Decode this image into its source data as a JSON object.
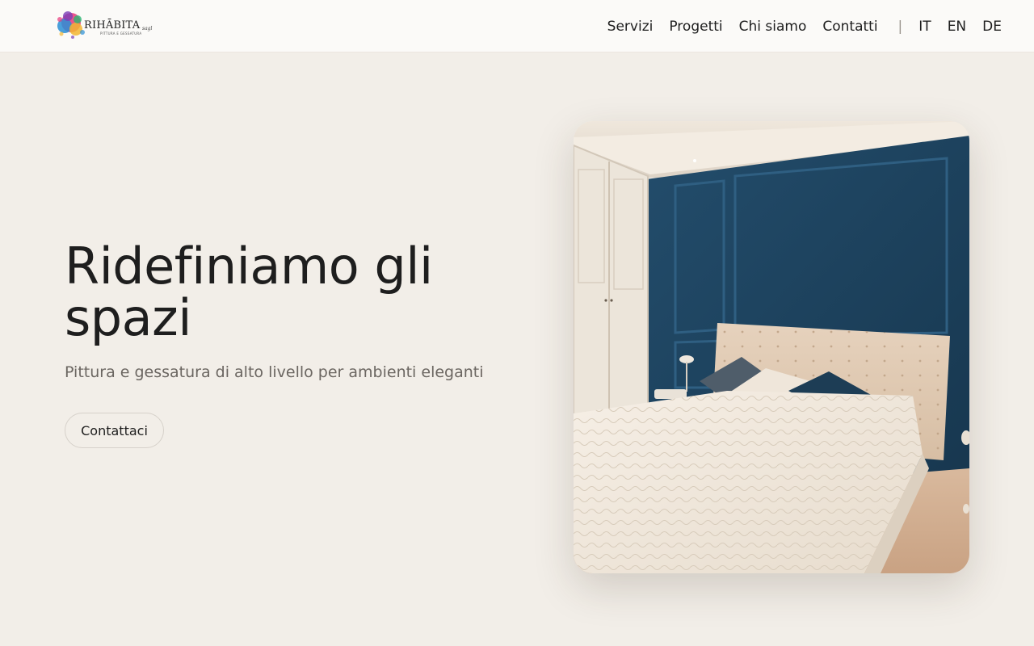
{
  "header": {
    "logo": {
      "wordmark": "RIHĀBITA",
      "suffix": "sagl",
      "tagline": "PITTURA E GESSATURA"
    },
    "nav": {
      "links": [
        {
          "label": "Servizi"
        },
        {
          "label": "Progetti"
        },
        {
          "label": "Chi siamo"
        },
        {
          "label": "Contatti"
        }
      ],
      "separator": "|",
      "languages": [
        {
          "label": "IT"
        },
        {
          "label": "EN"
        },
        {
          "label": "DE"
        }
      ]
    }
  },
  "hero": {
    "title": "Ridefiniamo gli spazi",
    "subtitle": "Pittura e gessatura di alto livello per ambienti eleganti",
    "cta_label": "Contattaci"
  },
  "photo": {
    "subject": "bedroom-with-blue-paneled-wall"
  },
  "colors": {
    "background": "#f2eee8",
    "header_background": "#fbfaf8",
    "text": "#1e1e1e",
    "muted_text": "#6b6661",
    "wall_blue": "#1f4663"
  }
}
